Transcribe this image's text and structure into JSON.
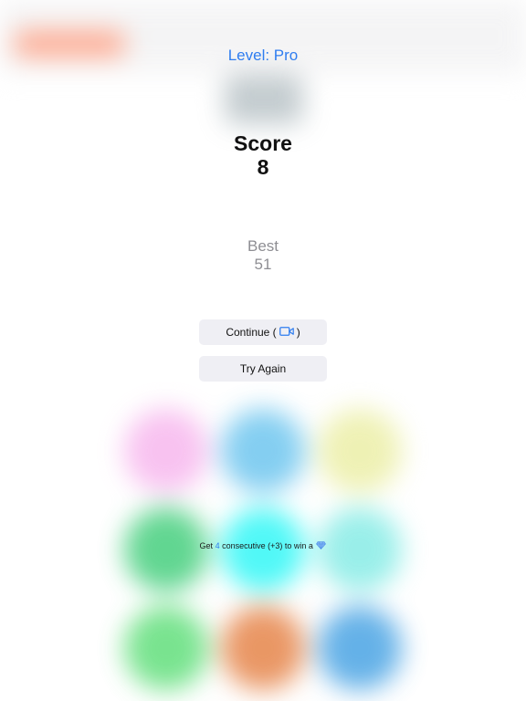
{
  "level": {
    "text": "Level: Pro"
  },
  "score": {
    "label": "Score",
    "value": "8"
  },
  "best": {
    "label": "Best",
    "value": "51"
  },
  "buttons": {
    "continue_label": "Continue (",
    "continue_suffix": ")",
    "continue_icon": "video-camera-icon",
    "try_again_label": "Try Again"
  },
  "hint": {
    "prefix": "Get",
    "count": "4",
    "suffix": "consecutive (+3) to win a",
    "icon": "gem-icon"
  },
  "colors": {
    "accent": "#2f7df0",
    "score_text": "#111111",
    "best_text": "#8e8e93",
    "button_bg": "#efeff4",
    "grid_circles": [
      "#f7b8ee",
      "#6fc6ef",
      "#ecefa8",
      "#46cf7e",
      "#33f7f6",
      "#88ece6",
      "#62df7c",
      "#e6854a",
      "#4aa4e4"
    ]
  }
}
